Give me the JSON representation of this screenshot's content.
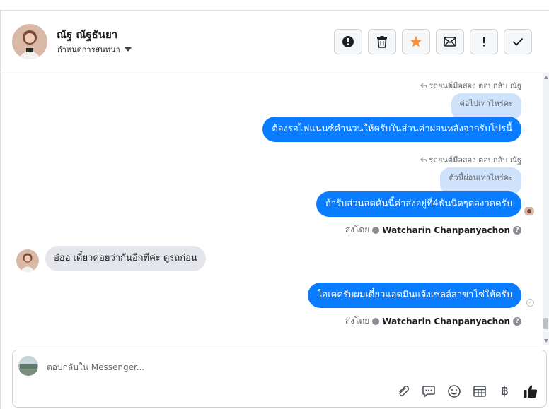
{
  "header": {
    "contact_name": "ณัฐ ณัฐธันยา",
    "conversation_settings": "กำหนดการสนทนา",
    "actions": [
      {
        "name": "mark-spam",
        "icon": "alert-circle-icon"
      },
      {
        "name": "delete",
        "icon": "trash-icon"
      },
      {
        "name": "star",
        "icon": "star-icon",
        "color": "#f7923a"
      },
      {
        "name": "mark-unread",
        "icon": "envelope-icon"
      },
      {
        "name": "follow-up",
        "icon": "exclamation-icon"
      },
      {
        "name": "done",
        "icon": "checkmark-icon"
      }
    ]
  },
  "thread": {
    "messages": [
      {
        "reply_meta": "รถยนต์มือสอง ตอบกลับ ณัฐ",
        "quoted": "ต่อไปเท่าไหร่คะ",
        "text": "ต้องรอไฟแนนซ์คำนวนให้ครับในส่วนค่าผ่อนหลังจากรับโปรนี้"
      },
      {
        "reply_meta": "รถยนต์มือสอง ตอบกลับ ณัฐ",
        "quoted": "ตัวนี้ผ่อนเท่าไหร่คะ",
        "text": "ถ้ารับส่วนลดคันนี้ค่าส่งอยู่ที่4พันนิดๆต่องวดครับ",
        "sent_by_prefix": "ส่งโดย",
        "sent_by_agent": "Watcharin Chanpanyachon"
      },
      {
        "incoming": true,
        "text": "อ๋ออ เดี๋ยวค่อยว่ากันอีกทีค่ะ ดูรถก่อน"
      },
      {
        "text": "โอเคครับผมเดี๋ยวแอดมินแจ้งเซลล์สาขาโซ่ให้ครับ",
        "sent_by_prefix": "ส่งโดย",
        "sent_by_agent": "Watcharin Chanpanyachon"
      }
    ]
  },
  "composer": {
    "placeholder": "ตอบกลับใน Messenger...",
    "tools": [
      "paperclip-icon",
      "chat-bubble-icon",
      "smiley-icon",
      "table-icon",
      "baht-icon",
      "thumbs-up-icon"
    ],
    "baht_symbol": "฿"
  },
  "colors": {
    "outgoing_bubble": "#0a7cff",
    "quoted_bubble": "#cfe2fb",
    "incoming_bubble": "#e4e6eb"
  }
}
